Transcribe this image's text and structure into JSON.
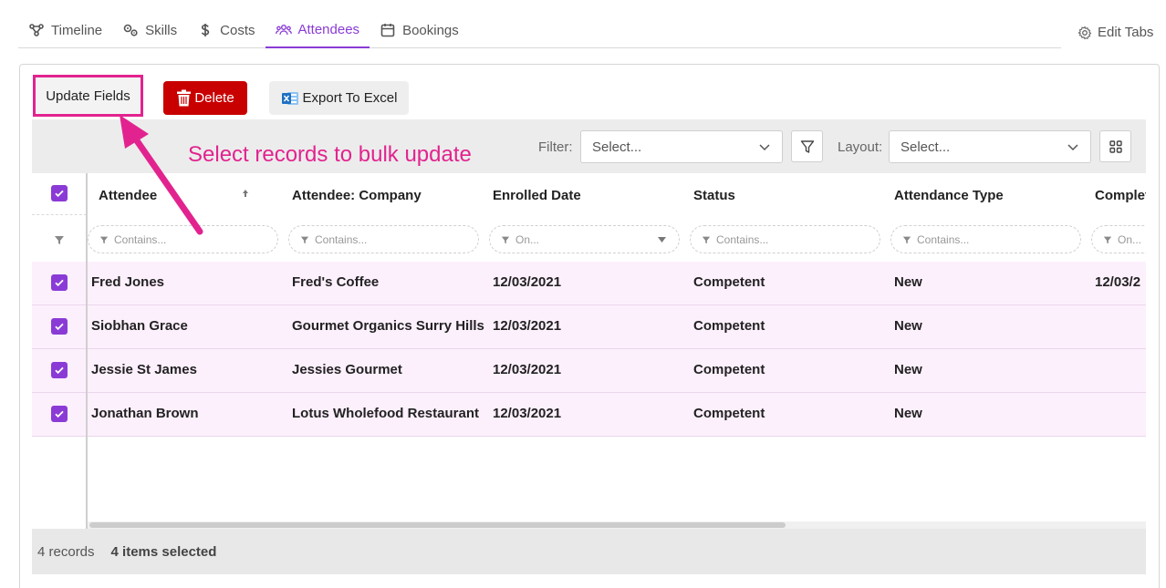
{
  "tabs": [
    {
      "label": "Timeline",
      "icon": "timeline-icon"
    },
    {
      "label": "Skills",
      "icon": "skills-icon"
    },
    {
      "label": "Costs",
      "icon": "dollar-icon"
    },
    {
      "label": "Attendees",
      "icon": "attendees-icon",
      "active": true
    },
    {
      "label": "Bookings",
      "icon": "calendar-icon"
    }
  ],
  "edit_tabs_label": "Edit Tabs",
  "actions": {
    "update_fields": "Update Fields",
    "delete": "Delete",
    "export": "Export To Excel"
  },
  "annotation": "Select records to bulk update",
  "toolbar": {
    "filter_label": "Filter:",
    "filter_placeholder": "Select...",
    "layout_label": "Layout:",
    "layout_placeholder": "Select..."
  },
  "columns": [
    {
      "label": "Attendee",
      "filter": "Contains..."
    },
    {
      "label": "Attendee: Company",
      "filter": "Contains..."
    },
    {
      "label": "Enrolled Date",
      "filter": "On..."
    },
    {
      "label": "Status",
      "filter": "Contains..."
    },
    {
      "label": "Attendance Type",
      "filter": "Contains..."
    },
    {
      "label": "Complet",
      "filter": "On..."
    }
  ],
  "rows": [
    {
      "attendee": "Fred Jones",
      "company": "Fred's Coffee",
      "enrolled": "12/03/2021",
      "status": "Competent",
      "type": "New",
      "completed": "12/03/2"
    },
    {
      "attendee": "Siobhan Grace",
      "company": "Gourmet Organics Surry Hills",
      "enrolled": "12/03/2021",
      "status": "Competent",
      "type": "New",
      "completed": ""
    },
    {
      "attendee": "Jessie St James",
      "company": "Jessies Gourmet",
      "enrolled": "12/03/2021",
      "status": "Competent",
      "type": "New",
      "completed": ""
    },
    {
      "attendee": "Jonathan Brown",
      "company": "Lotus Wholefood Restaurant",
      "enrolled": "12/03/2021",
      "status": "Competent",
      "type": "New",
      "completed": ""
    }
  ],
  "footer": {
    "records": "4 records",
    "selected": "4 items selected"
  },
  "colors": {
    "accent": "#8a3bd6",
    "annotation": "#e2238f",
    "delete": "#c80000",
    "row_selected": "#fdf0fd"
  }
}
